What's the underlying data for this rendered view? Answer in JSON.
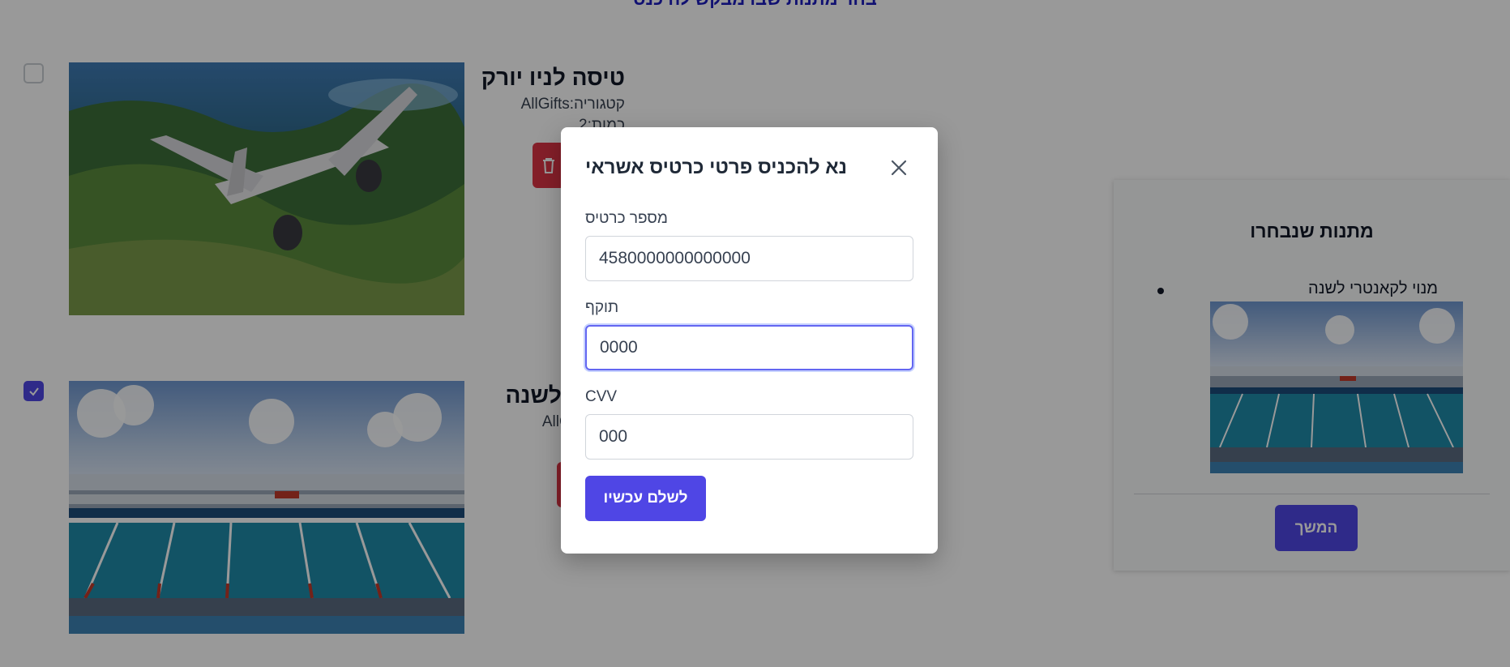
{
  "page": {
    "heading": "בחר מתנות שבו מבקש להיכנס"
  },
  "gifts": [
    {
      "title": "טיסה לניו יורק",
      "category_text": "קטגוריה:AllGifts",
      "quantity_text": "כמות:2",
      "checked": false,
      "icon": "trash-icon"
    },
    {
      "title": "מנוי לקאנטרי לשנה",
      "title_visible": "י לשנה",
      "category_text": "AllGi",
      "checked": true,
      "icon": "trash-icon"
    }
  ],
  "summary": {
    "title": "מתנות שנבחרו",
    "items": [
      {
        "name": "מנוי לקאנטרי לשנה"
      }
    ],
    "continue_label": "המשך"
  },
  "modal": {
    "title": "נא להכניס פרטי כרטיס אשראי",
    "close_icon": "close-icon",
    "fields": [
      {
        "label": "מספר כרטיס",
        "value": "4580000000000000"
      },
      {
        "label": "תוקף",
        "value": "0000"
      },
      {
        "label": "CVV",
        "value": "000"
      }
    ],
    "pay_label": "לשלם עכשיו"
  },
  "colors": {
    "accent": "#4f46e5",
    "danger": "#dc3545",
    "overlay": "rgba(0,0,0,0.4)"
  }
}
